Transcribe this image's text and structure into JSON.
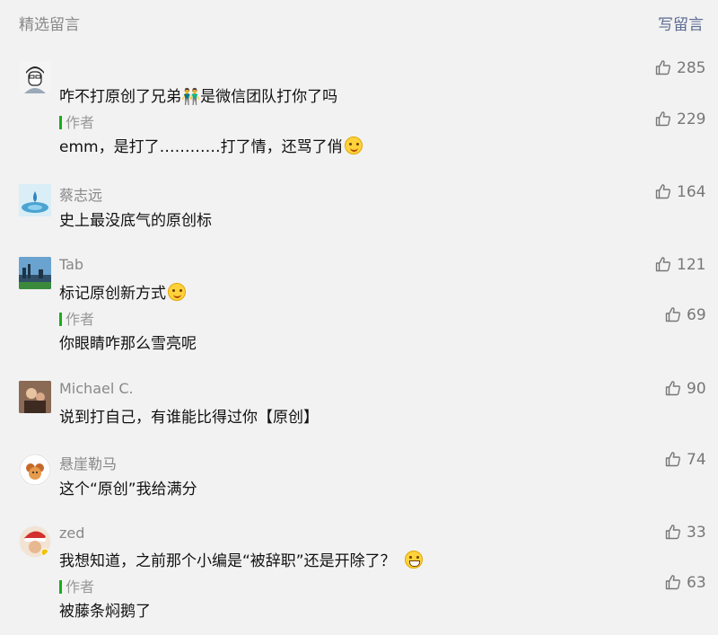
{
  "header": {
    "title": "精选留言",
    "write_label": "写留言"
  },
  "comments": [
    {
      "nickname": "",
      "text": "咋不打原创了兄弟👬是微信团队打你了吗",
      "likes": "285",
      "avatar_icon": "cartoon-boy-avatar",
      "reply": {
        "tag": "作者",
        "text": "emm，是打了…………打了情，还骂了俏",
        "likes": "229"
      }
    },
    {
      "nickname": "蔡志远",
      "text": "史上最没底气的原创标",
      "likes": "164",
      "avatar_icon": "water-drop-avatar"
    },
    {
      "nickname": "Tab",
      "text": "标记原创新方式",
      "likes": "121",
      "avatar_icon": "city-skyline-avatar",
      "reply": {
        "tag": "作者",
        "text": "你眼睛咋那么雪亮呢",
        "likes": "69"
      }
    },
    {
      "nickname": "Michael C.",
      "text": "说到打自己，有谁能比得过你【原创】",
      "likes": "90",
      "avatar_icon": "photo-avatar"
    },
    {
      "nickname": "悬崖勒马",
      "text": "这个“原创”我给满分",
      "likes": "74",
      "avatar_icon": "cartoon-avatar"
    },
    {
      "nickname": "zed",
      "text": "我想知道，之前那个小编是“被辞职”还是开除了？",
      "likes": "33",
      "avatar_icon": "santa-hat-avatar",
      "reply": {
        "tag": "作者",
        "text": "被藤条焖鹅了",
        "likes": "63"
      }
    }
  ],
  "colors": {
    "background": "#f2f2f2",
    "author_bar": "#1aad19",
    "link": "#5b6b91"
  }
}
